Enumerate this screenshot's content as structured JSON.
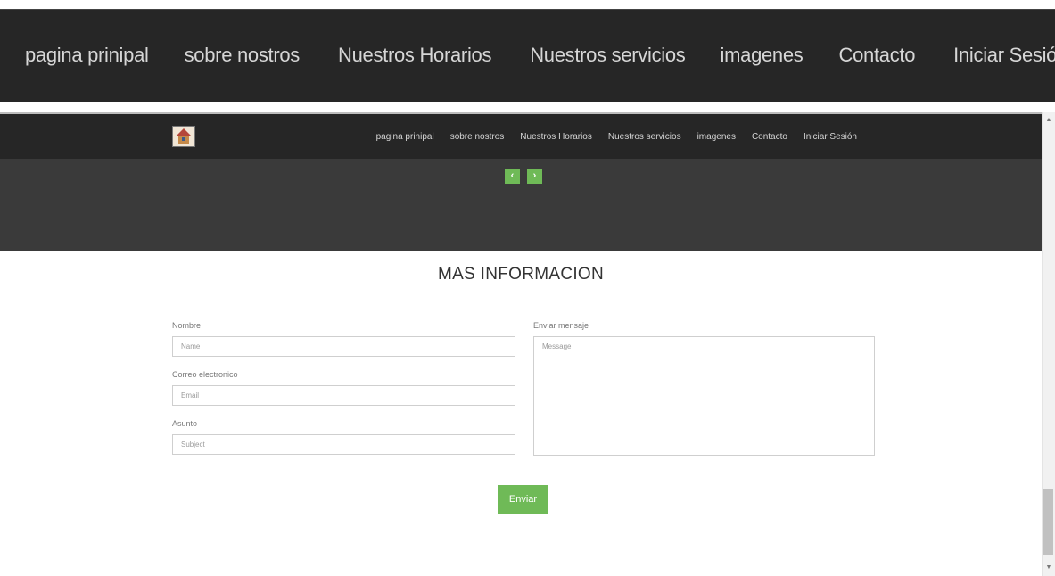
{
  "nav": {
    "items": [
      "pagina prinipal",
      "sobre nostros",
      "Nuestros Horarios",
      "Nuestros servicios",
      "imagenes",
      "Contacto",
      "Iniciar Sesión"
    ]
  },
  "slider": {
    "prev": "‹",
    "next": "›"
  },
  "form": {
    "title": "MAS INFORMACION",
    "name_label": "Nombre",
    "name_placeholder": "Name",
    "email_label": "Correo electronico",
    "email_placeholder": "Email",
    "subject_label": "Asunto",
    "subject_placeholder": "Subject",
    "message_label": "Enviar mensaje",
    "message_placeholder": "Message",
    "submit": "Enviar"
  },
  "scrollbar": {
    "up": "▲",
    "down": "▼"
  },
  "colors": {
    "header_bg": "#262626",
    "slider_bg": "#3a3a3a",
    "accent_green": "#6fba57",
    "nav_text": "#d6d6d6"
  }
}
